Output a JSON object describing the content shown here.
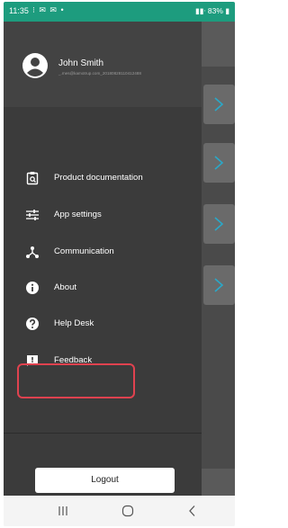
{
  "status_bar": {
    "time": "11:35",
    "notification_icons": "⁝ ✉ ✉ •",
    "battery": "83%"
  },
  "user": {
    "name": "John Smith",
    "email": "_.mes@kamotrup.com_20180828110412488"
  },
  "menu": [
    {
      "id": "product-documentation",
      "label": "Product documentation",
      "icon": "clipboard-search-icon"
    },
    {
      "id": "app-settings",
      "label": "App settings",
      "icon": "sliders-icon"
    },
    {
      "id": "communication",
      "label": "Communication",
      "icon": "hub-icon"
    },
    {
      "id": "about",
      "label": "About",
      "icon": "info-icon"
    },
    {
      "id": "help-desk",
      "label": "Help Desk",
      "icon": "help-icon"
    },
    {
      "id": "feedback",
      "label": "Feedback",
      "icon": "feedback-icon",
      "highlighted": true
    }
  ],
  "logout_label": "Logout",
  "colors": {
    "status_bar": "#1d9c7e",
    "drawer": "#3b3b3b",
    "highlight": "#e0424f"
  },
  "nav_bar": [
    "recent-apps-icon",
    "home-icon",
    "back-icon"
  ]
}
